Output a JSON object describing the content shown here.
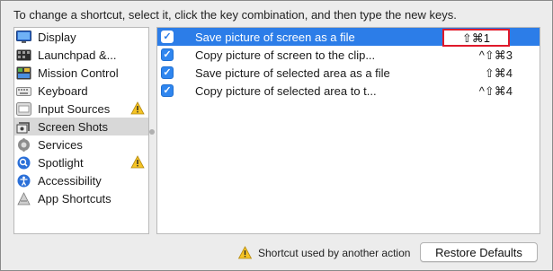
{
  "instruction": "To change a shortcut, select it, click the key combination, and then type the new keys.",
  "categories": [
    {
      "label": "Display",
      "icon": "display-icon",
      "warning": false
    },
    {
      "label": "Launchpad &...",
      "icon": "launchpad-icon",
      "warning": false
    },
    {
      "label": "Mission Control",
      "icon": "mission-control-icon",
      "warning": false
    },
    {
      "label": "Keyboard",
      "icon": "keyboard-icon",
      "warning": false
    },
    {
      "label": "Input Sources",
      "icon": "input-sources-icon",
      "warning": true
    },
    {
      "label": "Screen Shots",
      "icon": "screenshot-icon",
      "warning": false,
      "selected": true
    },
    {
      "label": "Services",
      "icon": "gear-icon",
      "warning": false
    },
    {
      "label": "Spotlight",
      "icon": "spotlight-icon",
      "warning": true
    },
    {
      "label": "Accessibility",
      "icon": "accessibility-icon",
      "warning": false
    },
    {
      "label": "App Shortcuts",
      "icon": "app-shortcuts-icon",
      "warning": false
    }
  ],
  "shortcuts": [
    {
      "label": "Save picture of screen as a file",
      "key": "⇧⌘1",
      "checked": true,
      "selected": true
    },
    {
      "label": "Copy picture of screen to the clip...",
      "key": "^⇧⌘3",
      "checked": true
    },
    {
      "label": "Save picture of selected area as a file",
      "key": "⇧⌘4",
      "checked": true
    },
    {
      "label": "Copy picture of selected area to t...",
      "key": "^⇧⌘4",
      "checked": true
    }
  ],
  "footer": {
    "conflict_text": "Shortcut used by another action",
    "restore_label": "Restore Defaults"
  },
  "colors": {
    "selection_blue": "#2c7de8",
    "highlight_red": "#e0192a",
    "warning_yellow": "#f5c324"
  }
}
